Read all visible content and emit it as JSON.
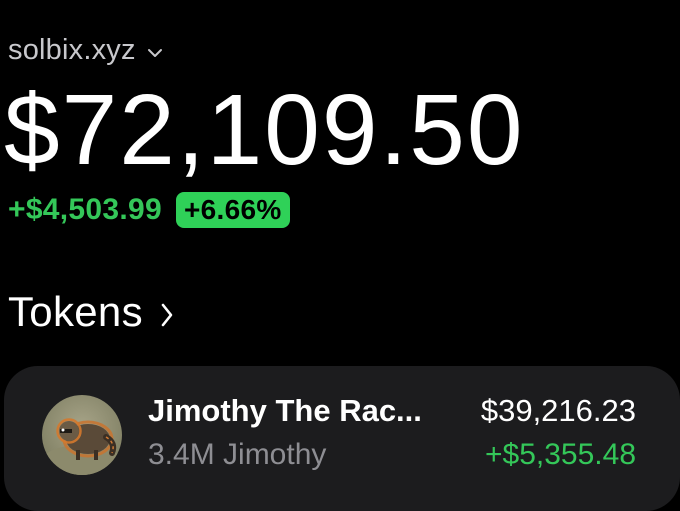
{
  "account": {
    "name": "solbix.xyz",
    "dropdown_icon": "chevron-down-icon"
  },
  "balance": {
    "total": "$72,109.50",
    "change_amount": "+$4,503.99",
    "change_percent": "+6.66%"
  },
  "tokens_section": {
    "title": "Tokens",
    "chevron_icon": "chevron-right-icon"
  },
  "tokens": [
    {
      "name": "Jimothy The Rac...",
      "quantity": "3.4M Jimothy",
      "value": "$39,216.23",
      "change": "+$5,355.48",
      "avatar_icon": "raccoon-avatar"
    }
  ],
  "colors": {
    "background": "#000000",
    "card": "#1c1c1e",
    "positive": "#34c759",
    "badge": "#2fd158",
    "secondary_text": "#8e8e93"
  }
}
